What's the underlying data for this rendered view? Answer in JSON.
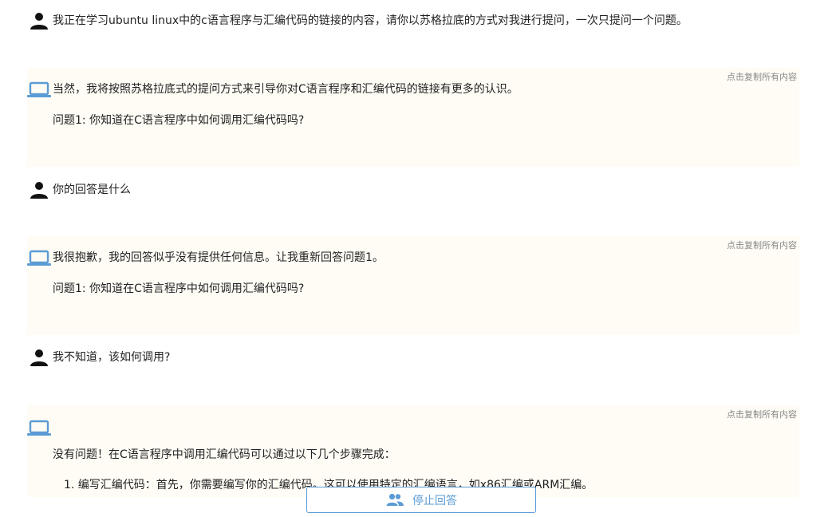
{
  "conversation": [
    {
      "role": "user",
      "avatar_icon": "user-icon",
      "lines": [
        "我正在学习ubuntu linux中的c语言程序与汇编代码的链接的内容，请你以苏格拉底的方式对我进行提问，一次只提问一个问题。"
      ]
    },
    {
      "role": "assistant",
      "avatar_icon": "laptop-icon",
      "copy_label": "点击复制所有内容",
      "lines": [
        "当然，我将按照苏格拉底式的提问方式来引导你对C语言程序和汇编代码的链接有更多的认识。",
        "问题1: 你知道在C语言程序中如何调用汇编代码吗?"
      ]
    },
    {
      "role": "user",
      "avatar_icon": "user-icon",
      "lines": [
        "你的回答是什么"
      ]
    },
    {
      "role": "assistant",
      "avatar_icon": "laptop-icon",
      "copy_label": "点击复制所有内容",
      "lines": [
        "我很抱歉，我的回答似乎没有提供任何信息。让我重新回答问题1。",
        "问题1: 你知道在C语言程序中如何调用汇编代码吗?"
      ]
    },
    {
      "role": "user",
      "avatar_icon": "user-icon",
      "lines": [
        "我不知道，该如何调用?"
      ]
    },
    {
      "role": "assistant",
      "avatar_icon": "laptop-icon",
      "copy_label": "点击复制所有内容",
      "lines": [
        "没有问题！在C语言程序中调用汇编代码可以通过以下几个步骤完成：",
        "1. 编写汇编代码：首先，你需要编写你的汇编代码。这可以使用特定的汇编语言，如x86汇编或ARM汇编。"
      ]
    }
  ],
  "stop_button": {
    "label": "停止回答",
    "icon": "people-icon"
  },
  "colors": {
    "assistant_bg": "#fffcf5",
    "accent_blue": "#5b9bd5",
    "user_icon": "#111111",
    "copy_text": "#888888"
  }
}
